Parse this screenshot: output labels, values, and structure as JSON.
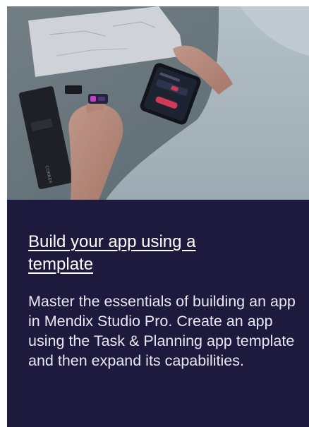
{
  "card": {
    "image_alt": "Person holding a small device next to a phone with an app on a table",
    "title": "Build your app using a template",
    "description": "Master the essentials of building an app in Mendix Studio Pro. Create an app using the Task & Planning app template and then expand its capabilities.",
    "colors": {
      "background": "#1e1a3d",
      "title": "#ffffff",
      "text": "#e8e7f2"
    }
  }
}
